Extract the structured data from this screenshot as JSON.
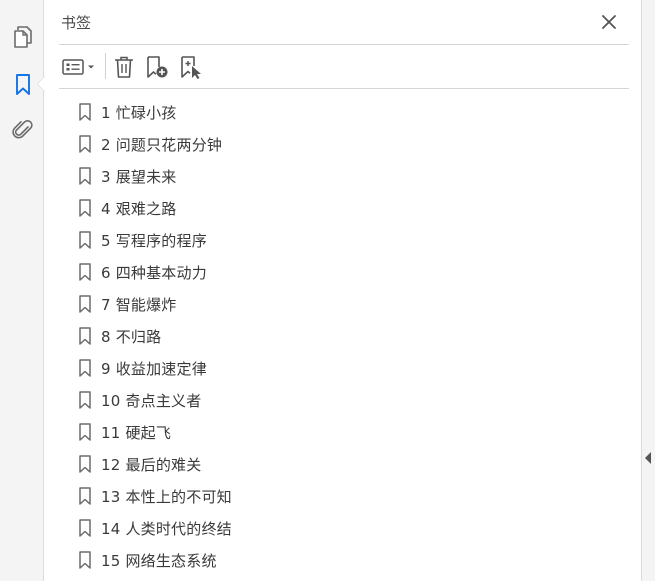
{
  "panel": {
    "title": "书签"
  },
  "rail": {
    "icons": [
      "pages-icon",
      "bookmark-icon",
      "attachment-icon"
    ],
    "active": "bookmark-icon",
    "active_color": "#1473e6"
  },
  "toolbar": {
    "buttons": [
      "options-menu-icon",
      "delete-bookmark-icon",
      "new-bookmark-icon",
      "new-bookmark-from-structure-icon"
    ]
  },
  "bookmarks": [
    {
      "label": "1  忙碌小孩"
    },
    {
      "label": "2  问题只花两分钟"
    },
    {
      "label": "3  展望未来"
    },
    {
      "label": "4  艰难之路"
    },
    {
      "label": "5  写程序的程序"
    },
    {
      "label": "6  四种基本动力"
    },
    {
      "label": "7  智能爆炸"
    },
    {
      "label": "8  不归路"
    },
    {
      "label": "9  收益加速定律"
    },
    {
      "label": "10  奇点主义者"
    },
    {
      "label": "11  硬起飞"
    },
    {
      "label": "12  最后的难关"
    },
    {
      "label": "13  本性上的不可知"
    },
    {
      "label": "14  人类时代的终结"
    },
    {
      "label": "15  网络生态系统"
    }
  ],
  "colors": {
    "icon_gray": "#6b6b6b",
    "divider": "#d6d6d6",
    "accent": "#1473e6"
  }
}
